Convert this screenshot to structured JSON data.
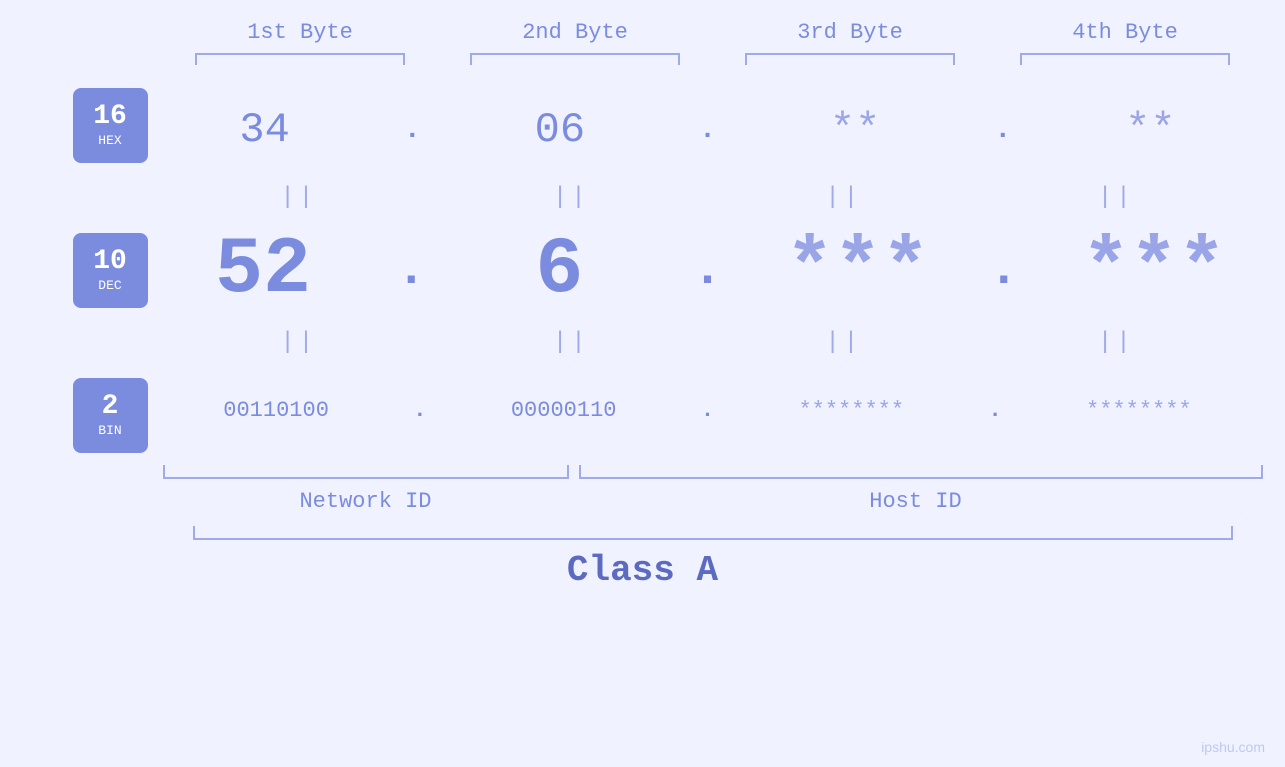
{
  "header": {
    "byte1": "1st Byte",
    "byte2": "2nd Byte",
    "byte3": "3rd Byte",
    "byte4": "4th Byte"
  },
  "badges": {
    "hex": {
      "number": "16",
      "label": "HEX"
    },
    "dec": {
      "number": "10",
      "label": "DEC"
    },
    "bin": {
      "number": "2",
      "label": "BIN"
    }
  },
  "hex_row": {
    "b1": "34",
    "b2": "06",
    "b3": "**",
    "b4": "**",
    "dots": [
      ".",
      ".",
      "."
    ]
  },
  "dec_row": {
    "b1": "52",
    "b2": "6",
    "b3": "***",
    "b4": "***",
    "dots": [
      ".",
      ".",
      "."
    ]
  },
  "bin_row": {
    "b1": "00110100",
    "b2": "00000110",
    "b3": "********",
    "b4": "********",
    "dots": [
      ".",
      ".",
      "."
    ]
  },
  "labels": {
    "network_id": "Network ID",
    "host_id": "Host ID",
    "class": "Class A"
  },
  "watermark": "ipshu.com"
}
